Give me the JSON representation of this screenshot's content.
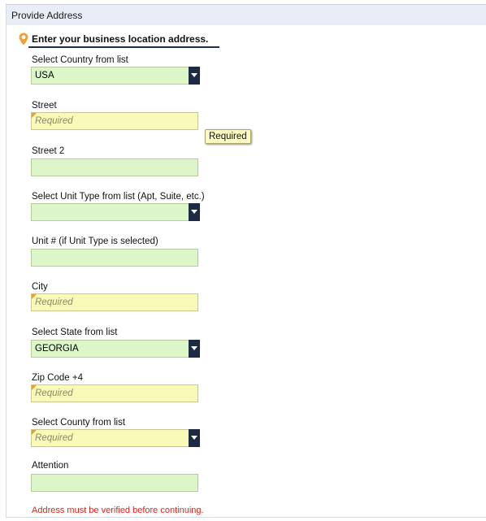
{
  "panel": {
    "title": "Provide Address"
  },
  "section": {
    "title": "Enter your business location address.",
    "icon": "map-pin-icon",
    "icon_color": "#f2a035"
  },
  "fields": {
    "country": {
      "label": "Select Country from list",
      "value": "USA"
    },
    "street": {
      "label": "Street",
      "placeholder": "Required"
    },
    "street2": {
      "label": "Street 2",
      "value": ""
    },
    "unit_type": {
      "label": "Select Unit Type from list (Apt, Suite, etc.)",
      "value": ""
    },
    "unit_number": {
      "label": "Unit # (if Unit Type is selected)",
      "value": ""
    },
    "city": {
      "label": "City",
      "placeholder": "Required"
    },
    "state": {
      "label": "Select State from list",
      "value": "GEORGIA"
    },
    "zip": {
      "label": "Zip Code +4",
      "placeholder": "Required"
    },
    "county": {
      "label": "Select County from list",
      "placeholder": "Required"
    },
    "attention": {
      "label": "Attention",
      "value": ""
    }
  },
  "tooltip": {
    "text": "Required"
  },
  "error": {
    "text": "Address must be verified before continuing."
  },
  "colors": {
    "valid_field": "#dcf6c9",
    "required_field": "#fafab8",
    "dropdown_button": "#1d2a44",
    "error_text": "#e2231a",
    "header_bg": "#e9edf8"
  }
}
